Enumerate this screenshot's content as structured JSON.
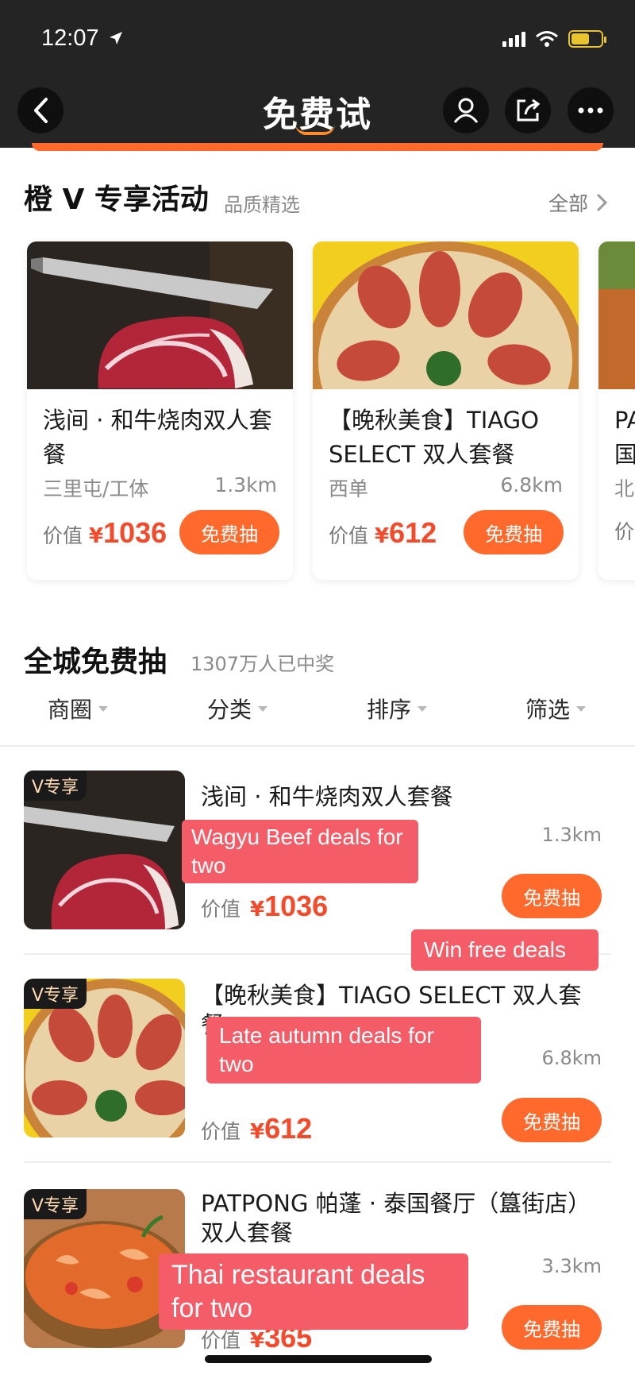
{
  "status": {
    "time": "12:07"
  },
  "nav": {
    "title": "免费试"
  },
  "exclusive": {
    "title": "橙 V 专享活动",
    "subtitle": "品质精选",
    "all_label": "全部",
    "cards": [
      {
        "name": "浅间 · 和牛烧肉双人套餐",
        "area": "三里屯/工体",
        "distance": "1.3km",
        "value_label": "价值",
        "currency": "¥",
        "price": "1036",
        "button": "免费抽"
      },
      {
        "name": "【晚秋美食】TIAGO SELECT 双人套餐",
        "area": "西单",
        "distance": "6.8km",
        "value_label": "价值",
        "currency": "¥",
        "price": "612",
        "button": "免费抽"
      },
      {
        "name": "PA 国",
        "area": "北",
        "value_label": "价"
      }
    ]
  },
  "citywide": {
    "title": "全城免费抽",
    "subtitle": "1307万人已中奖",
    "filters": [
      "商圈",
      "分类",
      "排序",
      "筛选"
    ],
    "items": [
      {
        "tag": "V专享",
        "name": "浅间 · 和牛烧肉双人套餐",
        "distance": "1.3km",
        "value_label": "价值",
        "currency": "¥",
        "price": "1036",
        "button": "免费抽"
      },
      {
        "tag": "V专享",
        "name": "【晚秋美食】TIAGO SELECT 双人套餐",
        "distance": "6.8km",
        "value_label": "价值",
        "currency": "¥",
        "price": "612",
        "button": "免费抽"
      },
      {
        "tag": "V专享",
        "name": "PATPONG 帕蓬 · 泰国餐厅（簋街店）双人套餐",
        "distance": "3.3km",
        "value_label": "价值",
        "currency": "¥",
        "price": "365",
        "button": "免费抽"
      }
    ]
  },
  "captions": {
    "wagyu": "Wagyu Beef deals for two",
    "win": "Win free deals",
    "autumn": "Late autumn deals for two",
    "thai": "Thai restaurant deals for two"
  },
  "colors": {
    "accent": "#ff6a2c",
    "price": "#f24a2a",
    "caption": "#f45d67",
    "topbar": "#242424"
  }
}
